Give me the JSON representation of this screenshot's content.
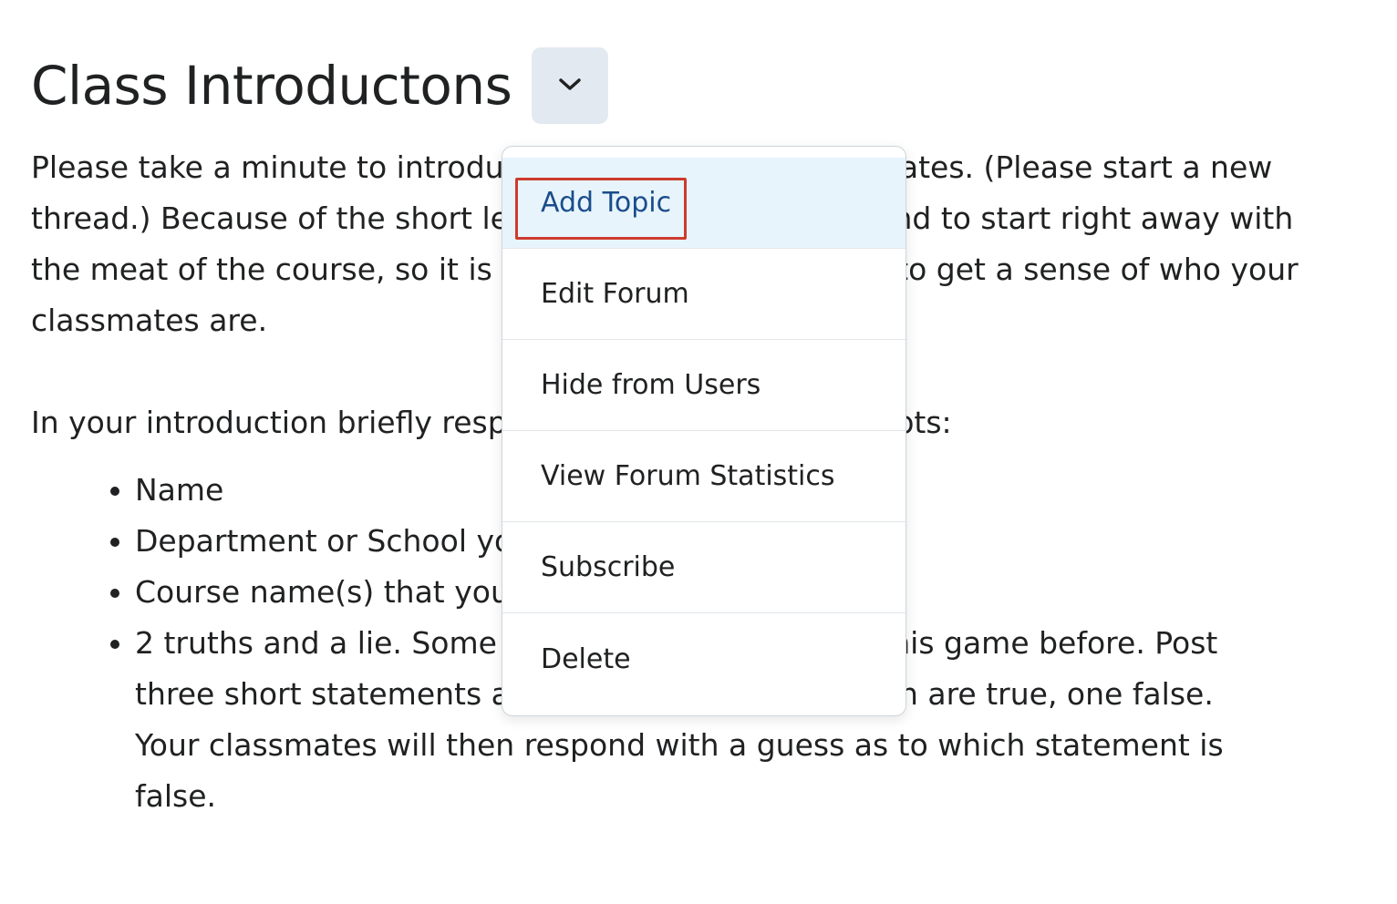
{
  "page": {
    "title": "Class Introductons"
  },
  "header": {
    "menu_icon": "chevron-down-icon"
  },
  "content": {
    "intro": "Please take a minute to introduce yourself to your classmates. (Please start a new thread.) Because of the short length of this course, we tend to start right away with the meat of the course, so it is important for each of you to get a sense of who your classmates are.",
    "prompt": "In your introduction briefly respond to the following prompts:",
    "bullets": [
      "Name",
      "Department or School you work in",
      "Course name(s) that you teach",
      "2 truths and a lie. Some of you may have played this game before. Post three short statements about yourself, two of which are true, one false. Your classmates will then respond with a guess as to which statement is false."
    ]
  },
  "menu": {
    "items": [
      {
        "label": "Add Topic"
      },
      {
        "label": "Edit Forum"
      },
      {
        "label": "Hide from Users"
      },
      {
        "label": "View Forum Statistics"
      },
      {
        "label": "Subscribe"
      },
      {
        "label": "Delete"
      }
    ]
  },
  "colors": {
    "accent_text": "#1a4d8c",
    "highlight_bg": "#e8f4fc",
    "focus_ring": "#cd3b2e",
    "button_bg": "#e3e9f1"
  }
}
